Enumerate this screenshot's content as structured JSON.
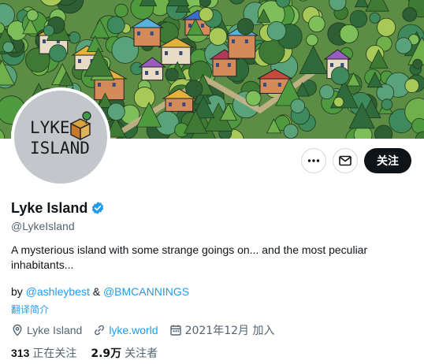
{
  "banner": {
    "image": "isometric-island-village-forest-illustration"
  },
  "avatar": {
    "logo_line1": "LYKE",
    "logo_line2": "ISLAND"
  },
  "actions": {
    "more_icon": "more-horizontal-icon",
    "message_icon": "envelope-icon",
    "follow_label": "关注"
  },
  "profile": {
    "name": "Lyke Island",
    "verified": true,
    "handle": "@LykeIsland",
    "bio": "A mysterious island with some strange goings on... and the most peculiar inhabitants...",
    "byline_prefix": "by ",
    "byline_user1": "@ashleybest",
    "byline_amp": " & ",
    "byline_user2": "@BMCANNINGS",
    "translate_label": "翻译简介"
  },
  "meta": {
    "location": "Lyke Island",
    "website": "lyke.world",
    "joined": "2021年12月 加入"
  },
  "stats": {
    "following_count": "313",
    "following_label": "正在关注",
    "followers_count": "2.9万",
    "followers_label": "关注者"
  },
  "colors": {
    "accent": "#1d9bf0",
    "text_primary": "#0f1419",
    "text_secondary": "#536471",
    "follow_bg": "#0f1419",
    "avatar_bg": "#c3c7cc"
  }
}
